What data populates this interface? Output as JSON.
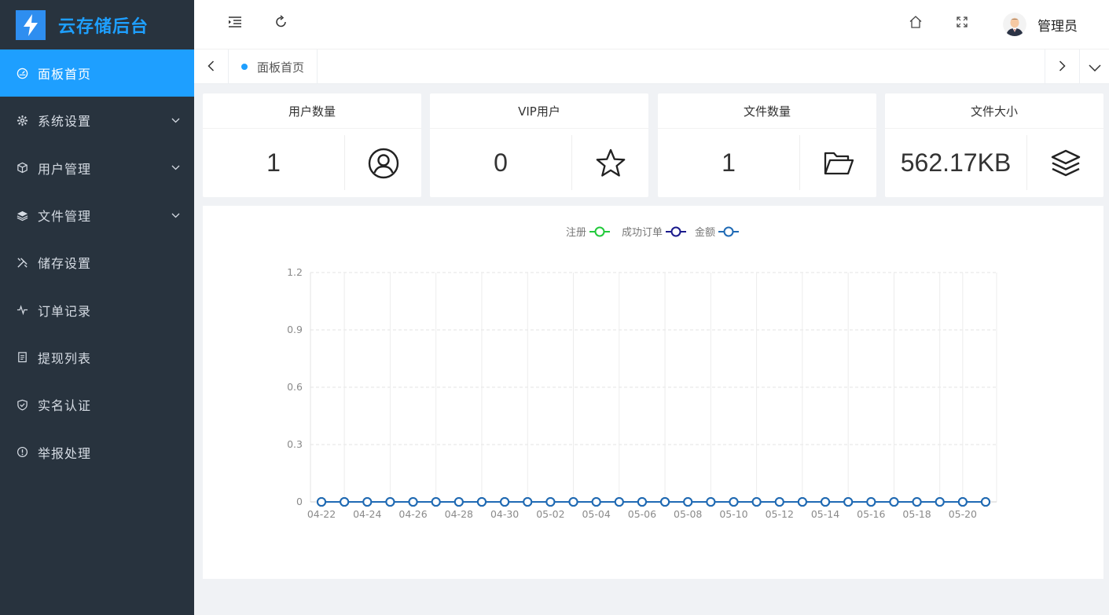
{
  "brand": {
    "title": "云存储后台"
  },
  "sidebar": {
    "items": [
      {
        "label": "面板首页",
        "icon": "dashboard-icon",
        "active": true,
        "expandable": false
      },
      {
        "label": "系统设置",
        "icon": "gear-icon",
        "active": false,
        "expandable": true
      },
      {
        "label": "用户管理",
        "icon": "cube-icon",
        "active": false,
        "expandable": true
      },
      {
        "label": "文件管理",
        "icon": "layers-icon",
        "active": false,
        "expandable": true
      },
      {
        "label": "储存设置",
        "icon": "tools-icon",
        "active": false,
        "expandable": false
      },
      {
        "label": "订单记录",
        "icon": "pulse-icon",
        "active": false,
        "expandable": false
      },
      {
        "label": "提现列表",
        "icon": "clipboard-icon",
        "active": false,
        "expandable": false
      },
      {
        "label": "实名认证",
        "icon": "shield-check-icon",
        "active": false,
        "expandable": false
      },
      {
        "label": "举报处理",
        "icon": "info-circle-icon",
        "active": false,
        "expandable": false
      }
    ]
  },
  "header": {
    "user_name": "管理员"
  },
  "tabs": [
    {
      "label": "面板首页",
      "active": true
    }
  ],
  "stats": [
    {
      "title": "用户数量",
      "value": "1",
      "icon": "user-circle-icon"
    },
    {
      "title": "VIP用户",
      "value": "0",
      "icon": "star-icon"
    },
    {
      "title": "文件数量",
      "value": "1",
      "icon": "folder-open-icon"
    },
    {
      "title": "文件大小",
      "value": "562.17KB",
      "icon": "layers-icon"
    }
  ],
  "colors": {
    "accent": "#1e9fff",
    "sidebar": "#28333e",
    "series_register": "#22c93b",
    "series_orders": "#1a1a8c",
    "series_amount": "#1f6ab5"
  },
  "chart_data": {
    "type": "line",
    "categories": [
      "04-22",
      "04-23",
      "04-24",
      "04-25",
      "04-26",
      "04-27",
      "04-28",
      "04-29",
      "04-30",
      "05-01",
      "05-02",
      "05-03",
      "05-04",
      "05-05",
      "05-06",
      "05-07",
      "05-08",
      "05-09",
      "05-10",
      "05-11",
      "05-12",
      "05-13",
      "05-14",
      "05-15",
      "05-16",
      "05-17",
      "05-18",
      "05-19",
      "05-20",
      "05-21"
    ],
    "series": [
      {
        "name": "注册",
        "color": "#22c93b",
        "values": [
          0,
          0,
          0,
          0,
          0,
          0,
          0,
          0,
          0,
          0,
          0,
          0,
          0,
          0,
          0,
          0,
          0,
          0,
          0,
          0,
          0,
          0,
          0,
          0,
          0,
          0,
          0,
          0,
          0,
          0
        ]
      },
      {
        "name": "成功订单",
        "color": "#1a1a8c",
        "values": [
          0,
          0,
          0,
          0,
          0,
          0,
          0,
          0,
          0,
          0,
          0,
          0,
          0,
          0,
          0,
          0,
          0,
          0,
          0,
          0,
          0,
          0,
          0,
          0,
          0,
          0,
          0,
          0,
          0,
          0
        ]
      },
      {
        "name": "金额",
        "color": "#1f6ab5",
        "values": [
          0,
          0,
          0,
          0,
          0,
          0,
          0,
          0,
          0,
          0,
          0,
          0,
          0,
          0,
          0,
          0,
          0,
          0,
          0,
          0,
          0,
          0,
          0,
          0,
          0,
          0,
          0,
          0,
          0,
          0
        ]
      }
    ],
    "y_ticks": [
      "0",
      "0.3",
      "0.6",
      "0.9",
      "1.2"
    ],
    "ylim": [
      0,
      1.2
    ],
    "x_tick_labels": [
      "04-22",
      "04-24",
      "04-26",
      "04-28",
      "04-30",
      "05-02",
      "05-04",
      "05-06",
      "05-08",
      "05-10",
      "05-12",
      "05-14",
      "05-16",
      "05-18",
      "05-20"
    ],
    "legend_position": "top-center",
    "grid": true
  }
}
